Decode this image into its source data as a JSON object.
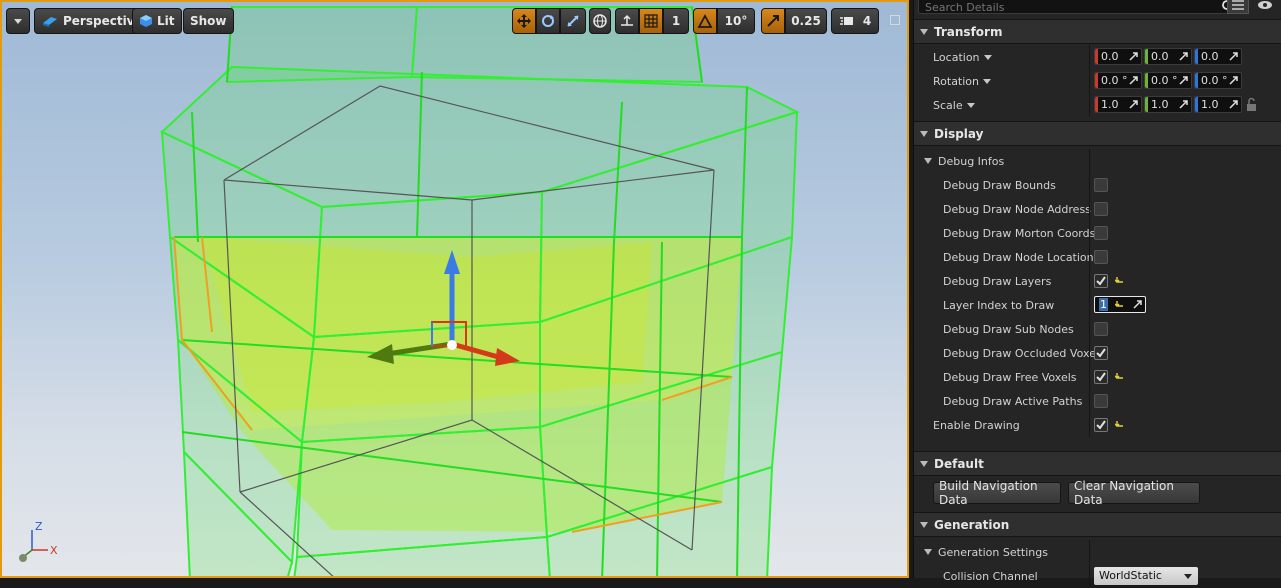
{
  "viewport": {
    "menu_caret": "chevron-down-icon",
    "perspective_label": "Perspective",
    "lit_label": "Lit",
    "show_label": "Show",
    "grid_snap_value": "1",
    "rotation_snap_value": "10°",
    "scale_snap_value": "0.25",
    "camera_speed_value": "4",
    "axis_labels": {
      "z": "Z",
      "x": "X"
    },
    "accent_color": "#e39a0c"
  },
  "details": {
    "search_placeholder": "Search Details",
    "transform": {
      "title": "Transform",
      "location": {
        "label": "Location",
        "x": "0.0",
        "y": "0.0",
        "z": "0.0"
      },
      "rotation": {
        "label": "Rotation",
        "x": "0.0 °",
        "y": "0.0 °",
        "z": "0.0 °"
      },
      "scale": {
        "label": "Scale",
        "x": "1.0",
        "y": "1.0",
        "z": "1.0"
      }
    },
    "display": {
      "title": "Display",
      "debug_infos": "Debug Infos",
      "items": [
        {
          "label": "Debug Draw Bounds",
          "checked": false,
          "reset": false
        },
        {
          "label": "Debug Draw Node Address",
          "checked": false,
          "reset": false
        },
        {
          "label": "Debug Draw Morton Coords",
          "checked": false,
          "reset": false
        },
        {
          "label": "Debug Draw Node Location",
          "checked": false,
          "reset": false
        },
        {
          "label": "Debug Draw Layers",
          "checked": true,
          "reset": true
        },
        {
          "label": "Layer Index to Draw",
          "value": "1",
          "reset": true
        },
        {
          "label": "Debug Draw Sub Nodes",
          "checked": false,
          "reset": false
        },
        {
          "label": "Debug Draw Occluded Voxels",
          "checked": true,
          "reset": false
        },
        {
          "label": "Debug Draw Free Voxels",
          "checked": true,
          "reset": true
        },
        {
          "label": "Debug Draw Active Paths",
          "checked": false,
          "reset": false
        }
      ],
      "enable_drawing": {
        "label": "Enable Drawing",
        "checked": true,
        "reset": true
      }
    },
    "default": {
      "title": "Default",
      "build_button": "Build Navigation Data",
      "clear_button": "Clear Navigation Data"
    },
    "generation": {
      "title": "Generation",
      "settings_label": "Generation Settings",
      "collision_channel_label": "Collision Channel",
      "collision_channel_value": "WorldStatic"
    }
  }
}
